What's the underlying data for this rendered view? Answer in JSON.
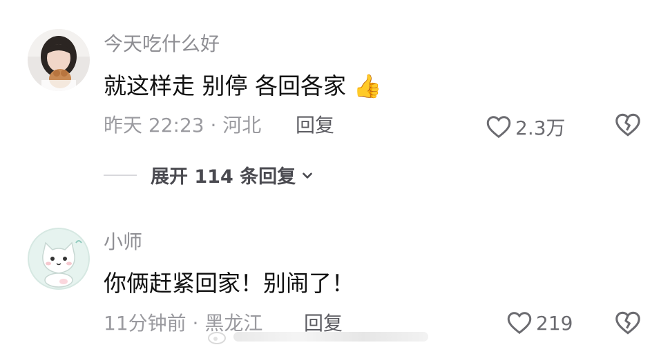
{
  "comments": [
    {
      "username": "今天吃什么好",
      "text": "就这样走 别停 各回各家",
      "emoji": "👍",
      "time_location": "昨天 22:23 · 河北",
      "reply_label": "回复",
      "like_count": "2.3万",
      "expand_label": "展开 114 条回复",
      "avatar_icon": "girl-photo-avatar"
    },
    {
      "username": "小师",
      "text": "你俩赶紧回家！别闹了！",
      "time_location": "11分钟前 · 黑龙江",
      "reply_label": "回复",
      "like_count": "219",
      "avatar_icon": "cartoon-cat-avatar"
    }
  ],
  "colors": {
    "username": "#8e8e93",
    "content": "#111111",
    "meta": "#9a9a9f",
    "icon": "#6b6b70"
  }
}
